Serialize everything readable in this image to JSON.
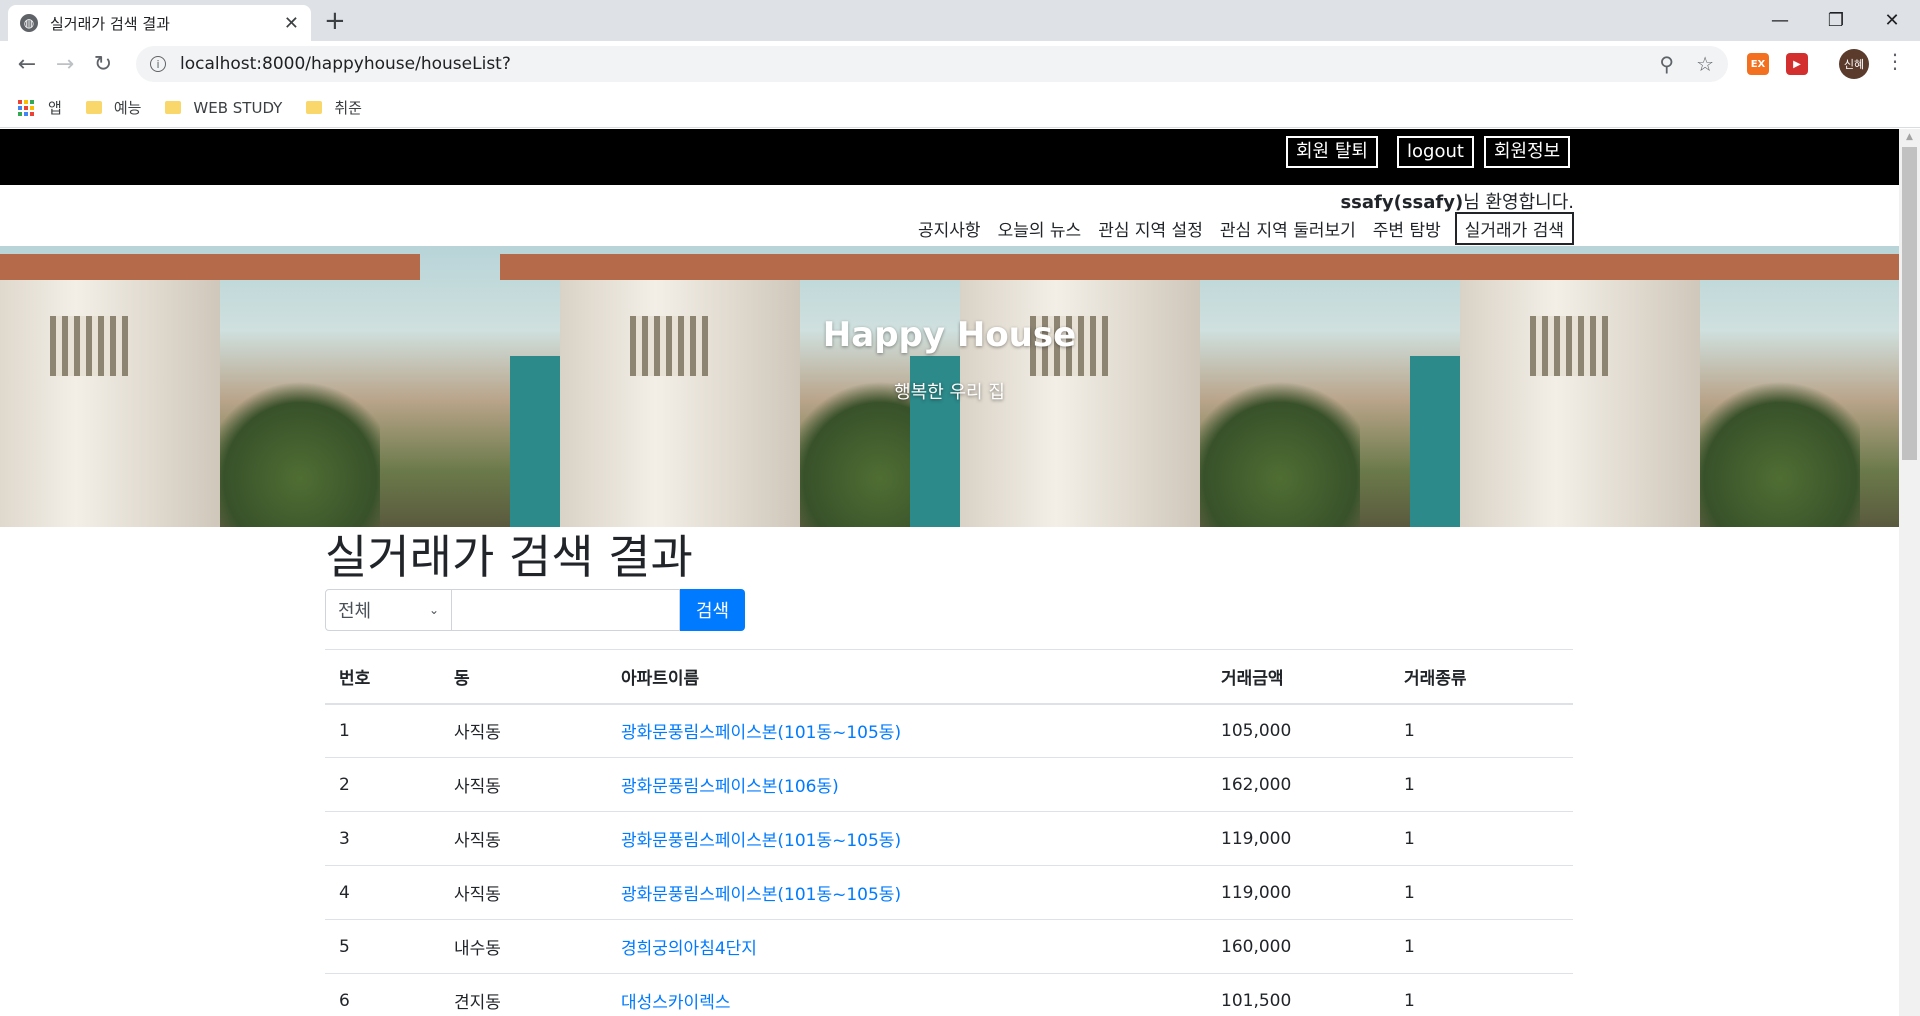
{
  "browser": {
    "tab_title": "실거래가 검색 결과",
    "url": "localhost:8000/happyhouse/houseList?",
    "profile_label": "신혜",
    "bookmarks": [
      {
        "label": "앱"
      },
      {
        "label": "예능"
      },
      {
        "label": "WEB STUDY"
      },
      {
        "label": "취준"
      }
    ],
    "extensions": [
      {
        "label": "EX",
        "color": "#f37021"
      },
      {
        "label": "▶",
        "color": "#d32f2f"
      }
    ]
  },
  "topbar": {
    "buttons": [
      "회원 탈퇴",
      "logout",
      "회원정보"
    ]
  },
  "welcome": {
    "user": "ssafy(ssafy)",
    "suffix": "님 환영합니다."
  },
  "menu": {
    "items": [
      "공지사항",
      "오늘의 뉴스",
      "관심 지역 설정",
      "관심 지역 둘러보기",
      "주변 탐방"
    ],
    "active": "실거래가 검색"
  },
  "hero": {
    "title": "Happy House",
    "subtitle": "행복한 우리 집"
  },
  "page": {
    "title": "실거래가 검색 결과",
    "search_select_value": "전체",
    "search_input_value": "",
    "search_button": "검색"
  },
  "table": {
    "headers": [
      "번호",
      "동",
      "아파트이름",
      "거래금액",
      "거래종류"
    ],
    "rows": [
      {
        "no": "1",
        "dong": "사직동",
        "apt": "광화문풍림스페이스본(101동~105동)",
        "price": "105,000",
        "type": "1"
      },
      {
        "no": "2",
        "dong": "사직동",
        "apt": "광화문풍림스페이스본(106동)",
        "price": "162,000",
        "type": "1"
      },
      {
        "no": "3",
        "dong": "사직동",
        "apt": "광화문풍림스페이스본(101동~105동)",
        "price": "119,000",
        "type": "1"
      },
      {
        "no": "4",
        "dong": "사직동",
        "apt": "광화문풍림스페이스본(101동~105동)",
        "price": "119,000",
        "type": "1"
      },
      {
        "no": "5",
        "dong": "내수동",
        "apt": "경희궁의아침4단지",
        "price": "160,000",
        "type": "1"
      },
      {
        "no": "6",
        "dong": "견지동",
        "apt": "대성스카이렉스",
        "price": "101,500",
        "type": "1"
      }
    ]
  },
  "colors": {
    "link": "#007bff",
    "primary_button": "#007bff",
    "topbar": "#000000"
  }
}
